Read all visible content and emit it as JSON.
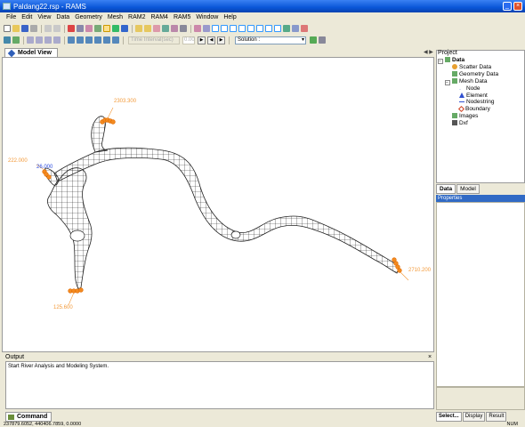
{
  "window": {
    "title": "Paldang22.rsp - RAMS"
  },
  "menu": [
    "File",
    "Edit",
    "View",
    "Data",
    "Geometry",
    "Mesh",
    "RAM2",
    "RAM4",
    "RAM5",
    "Window",
    "Help"
  ],
  "toolbar": {
    "time_interval_placeholder": "Time Interval(sec)",
    "time_value": "0.00",
    "solution_label": "Solution :"
  },
  "model_view": {
    "tab_label": "Model View",
    "labels": {
      "top": "2303.300",
      "left": "222.000",
      "left_blue": "26.000",
      "bottom": "125.600",
      "right": "2710.200"
    }
  },
  "project": {
    "title": "Project",
    "tree": [
      "Data",
      "Scatter Data",
      "Geometry Data",
      "Mesh Data",
      "Node",
      "Element",
      "Nodestring",
      "Boundary",
      "Images",
      "Dxf"
    ],
    "tabs": [
      "Data",
      "Model"
    ],
    "properties_title": "Properties",
    "bottom_tabs": [
      "Select...",
      "Display",
      "Result"
    ]
  },
  "output": {
    "title": "Output",
    "close": "×",
    "message": "Start River Analysis and Modeling System."
  },
  "command_tab": "Command",
  "status": {
    "coords": "237879.6052, 440406.7859, 0.0000",
    "num": "NUM"
  }
}
